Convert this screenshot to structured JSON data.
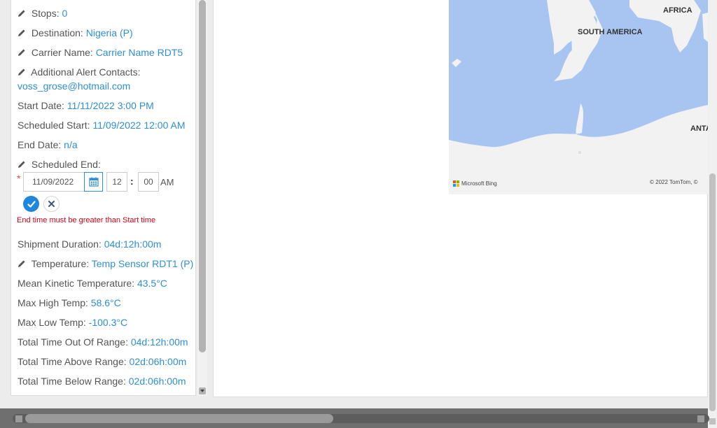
{
  "shipment": {
    "stops_label": "Stops:",
    "stops_value": "0",
    "destination_label": "Destination:",
    "destination_value": "Nigeria (P)",
    "carrier_label": "Carrier Name:",
    "carrier_value": "Carrier Name RDT5",
    "alert_label": "Additional Alert Contacts:",
    "alert_value": "voss_grose@hotmail.com",
    "start_date_label": "Start Date:",
    "start_date_value": "11/11/2022 3:00 PM",
    "scheduled_start_label": "Scheduled Start:",
    "scheduled_start_value": "11/09/2022 12:00 AM",
    "end_date_label": "End Date:",
    "end_date_value": "n/a",
    "scheduled_end_label": "Scheduled End:",
    "duration_label": "Shipment Duration:",
    "duration_value": "04d:12h:00m",
    "temperature_label": "Temperature:",
    "temperature_value": "Temp Sensor RDT1 (P)",
    "mkt_label": "Mean Kinetic Temperature:",
    "mkt_value": "43.5°C",
    "max_high_label": "Max High Temp:",
    "max_high_value": "58.6°C",
    "max_low_label": "Max Low Temp:",
    "max_low_value": "-100.3°C",
    "out_range_label": "Total Time Out Of Range:",
    "out_range_value": "04d:12h:00m",
    "above_range_label": "Total Time Above Range:",
    "above_range_value": "02d:06h:00m",
    "below_range_label": "Total Time Below Range:",
    "below_range_value": "02d:06h:00m"
  },
  "end_editor": {
    "required_mark": "*",
    "date_value": "11/09/2022",
    "hour_value": "12",
    "minute_value": "00",
    "colon": ":",
    "ampm": "AM",
    "error": "End time must be greater than Start time"
  },
  "map": {
    "labels": {
      "africa": "AFRICA",
      "south_america": "SOUTH AMERICA",
      "antarctica": "ANTA"
    },
    "provider": "Microsoft Bing",
    "copyright": "© 2022 TomTom, ©"
  },
  "colors": {
    "link": "#2f8fd6",
    "error": "#d0021b",
    "water": "#a8c5f1",
    "land": "#f2f2f2",
    "accent": "#1f86e0"
  }
}
